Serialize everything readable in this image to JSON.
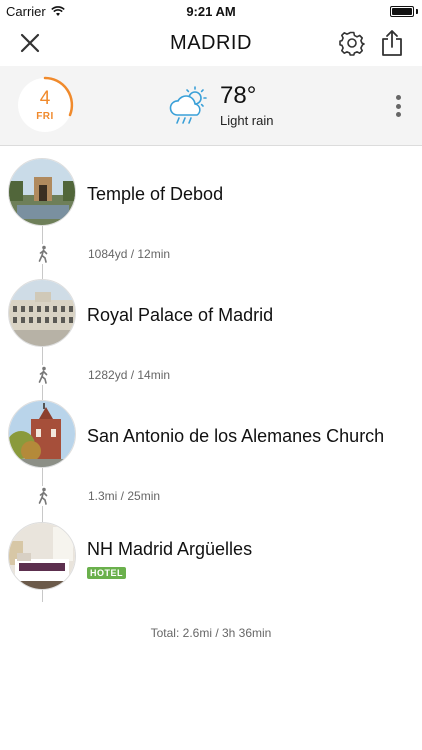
{
  "status_bar": {
    "carrier": "Carrier",
    "time": "9:21 AM"
  },
  "header": {
    "title": "MADRID",
    "close_icon": "close-icon",
    "settings_icon": "gear-icon",
    "share_icon": "share-icon"
  },
  "day": {
    "number": "4",
    "weekday": "FRI",
    "accent_color": "#f08a2c"
  },
  "weather": {
    "icon": "cloud-sun-rain-icon",
    "temperature": "78°",
    "condition": "Light rain",
    "icon_color": "#3aa0d8"
  },
  "stops": [
    {
      "name": "Temple of Debod"
    },
    {
      "name": "Royal Palace of Madrid"
    },
    {
      "name": "San Antonio de los Alemanes Church"
    },
    {
      "name": "NH Madrid Argüelles",
      "badge": "HOTEL"
    }
  ],
  "legs": [
    {
      "mode_icon": "walk-icon",
      "text": "1084yd / 12min"
    },
    {
      "mode_icon": "walk-icon",
      "text": "1282yd / 14min"
    },
    {
      "mode_icon": "walk-icon",
      "text": "1.3mi / 25min"
    }
  ],
  "total": "Total: 2.6mi / 3h 36min"
}
